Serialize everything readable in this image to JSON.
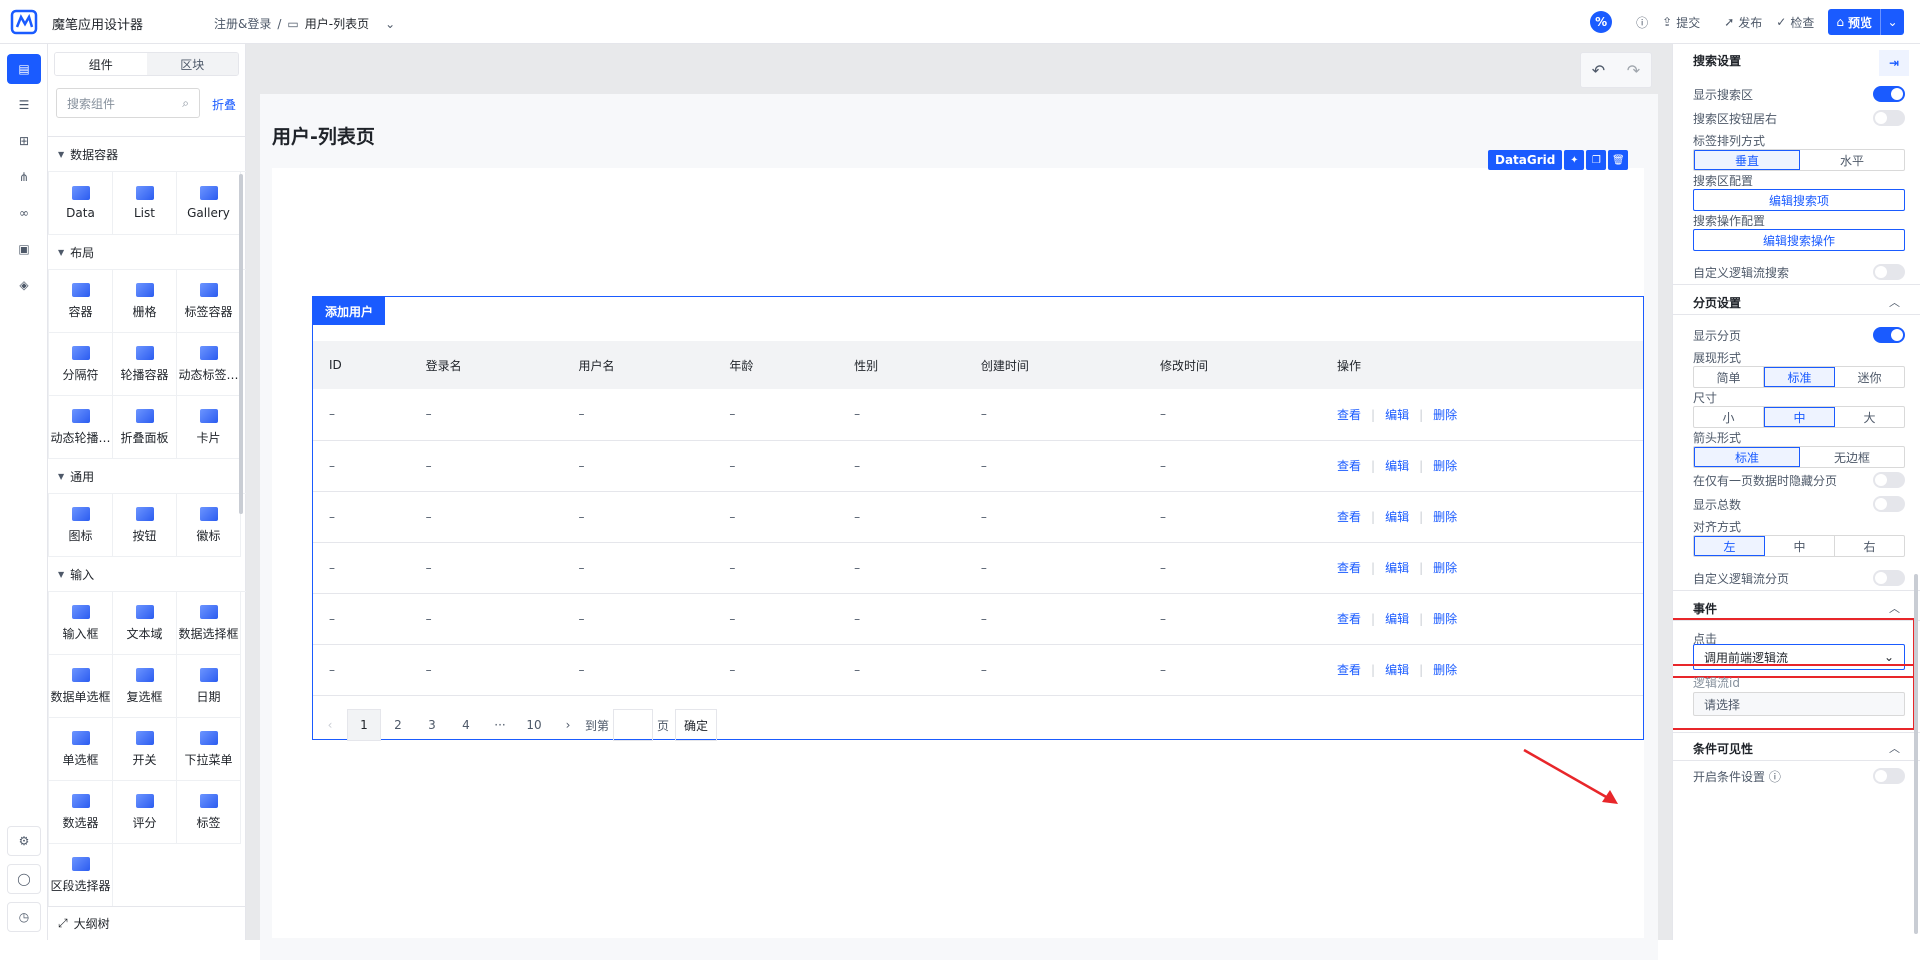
{
  "app": {
    "name": "魔笔应用设计器"
  },
  "breadcrumb": {
    "parent": "注册&登录",
    "sep": "/",
    "current": "用户-列表页"
  },
  "toolbar": {
    "badge": "%",
    "submit": "提交",
    "publish": "发布",
    "check": "检查",
    "preview": "预览"
  },
  "panel": {
    "tabs": [
      "组件",
      "区块"
    ],
    "search_placeholder": "搜索组件",
    "fold": "折叠",
    "categories": [
      {
        "name": "数据容器",
        "items": [
          "Data",
          "List",
          "Gallery"
        ]
      },
      {
        "name": "布局",
        "items": [
          "容器",
          "栅格",
          "标签容器",
          "分隔符",
          "轮播容器",
          "动态标签…",
          "动态轮播…",
          "折叠面板",
          "卡片"
        ]
      },
      {
        "name": "通用",
        "items": [
          "图标",
          "按钮",
          "徽标"
        ]
      },
      {
        "name": "输入",
        "items": [
          "输入框",
          "文本域",
          "数据选择框",
          "数据单选框",
          "复选框",
          "日期",
          "单选框",
          "开关",
          "下拉菜单",
          "数选器",
          "评分",
          "标签",
          "区段选择器"
        ]
      }
    ],
    "outline": "大纲树"
  },
  "page": {
    "title": "用户-列表页"
  },
  "datagrid": {
    "tag": "DataGrid",
    "add_button": "添加用户",
    "columns": [
      "ID",
      "登录名",
      "用户名",
      "年龄",
      "性别",
      "创建时间",
      "修改时间",
      "操作"
    ],
    "rows": [
      [
        "–",
        "–",
        "–",
        "–",
        "–",
        "–",
        "–"
      ],
      [
        "–",
        "–",
        "–",
        "–",
        "–",
        "–",
        "–"
      ],
      [
        "–",
        "–",
        "–",
        "–",
        "–",
        "–",
        "–"
      ],
      [
        "–",
        "–",
        "–",
        "–",
        "–",
        "–",
        "–"
      ],
      [
        "–",
        "–",
        "–",
        "–",
        "–",
        "–",
        "–"
      ],
      [
        "–",
        "–",
        "–",
        "–",
        "–",
        "–",
        "–"
      ]
    ],
    "ops": [
      "查看",
      "编辑",
      "删除"
    ],
    "pager": {
      "prev": "‹",
      "pages": [
        "1",
        "2",
        "3",
        "4",
        "···",
        "10"
      ],
      "next": "›",
      "goto": "到第",
      "page_unit": "页",
      "confirm": "确定"
    }
  },
  "props": {
    "search_settings": "搜索设置",
    "show_search": "显示搜索区",
    "search_btn_right": "搜索区按钮居右",
    "label_layout": "标签排列方式",
    "label_layout_opts": [
      "垂直",
      "水平"
    ],
    "search_config": "搜索区配置",
    "edit_search_items": "编辑搜索项",
    "search_op_config": "搜索操作配置",
    "edit_search_ops": "编辑搜索操作",
    "custom_logic_search": "自定义逻辑流搜索",
    "pagination_settings": "分页设置",
    "show_pagination": "显示分页",
    "display_form": "展现形式",
    "display_form_opts": [
      "简单",
      "标准",
      "迷你"
    ],
    "size": "尺寸",
    "size_opts": [
      "小",
      "中",
      "大"
    ],
    "arrow_form": "箭头形式",
    "arrow_form_opts": [
      "标准",
      "无边框"
    ],
    "hide_single_page": "在仅有一页数据时隐藏分页",
    "show_total": "显示总数",
    "align": "对齐方式",
    "align_opts": [
      "左",
      "中",
      "右"
    ],
    "custom_logic_pagination": "自定义逻辑流分页",
    "events": "事件",
    "click": "点击",
    "click_value": "调用前端逻辑流",
    "logic_id": "逻辑流id",
    "logic_placeholder": "请选择",
    "conditional_visibility": "条件可见性",
    "enable_condition": "开启条件设置"
  },
  "colors": {
    "accent": "#1a5bff",
    "highlight": "#e8262a"
  }
}
